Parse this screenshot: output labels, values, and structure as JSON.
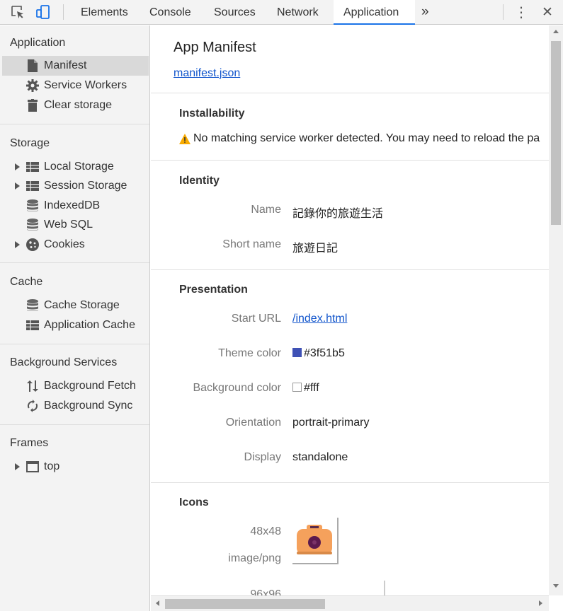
{
  "toolbar": {
    "tabs": [
      "Elements",
      "Console",
      "Sources",
      "Network",
      "Application"
    ],
    "active_tab": "Application",
    "more_glyph": "»",
    "menu_glyph": "⋮",
    "close_glyph": "✕"
  },
  "sidebar": {
    "application": {
      "heading": "Application",
      "items": [
        {
          "label": "Manifest",
          "icon": "document-icon"
        },
        {
          "label": "Service Workers",
          "icon": "gear-icon"
        },
        {
          "label": "Clear storage",
          "icon": "trash-icon"
        }
      ]
    },
    "storage": {
      "heading": "Storage",
      "items": [
        {
          "label": "Local Storage",
          "icon": "grid-icon"
        },
        {
          "label": "Session Storage",
          "icon": "grid-icon"
        },
        {
          "label": "IndexedDB",
          "icon": "database-icon"
        },
        {
          "label": "Web SQL",
          "icon": "database-icon"
        },
        {
          "label": "Cookies",
          "icon": "cookie-icon"
        }
      ]
    },
    "cache": {
      "heading": "Cache",
      "items": [
        {
          "label": "Cache Storage",
          "icon": "database-icon"
        },
        {
          "label": "Application Cache",
          "icon": "grid-icon"
        }
      ]
    },
    "background": {
      "heading": "Background Services",
      "items": [
        {
          "label": "Background Fetch",
          "icon": "arrows-updown-icon"
        },
        {
          "label": "Background Sync",
          "icon": "sync-icon"
        }
      ]
    },
    "frames": {
      "heading": "Frames",
      "items": [
        {
          "label": "top",
          "icon": "frame-icon"
        }
      ]
    }
  },
  "main": {
    "title": "App Manifest",
    "manifest_link": "manifest.json",
    "installability": {
      "title": "Installability",
      "warning": "No matching service worker detected. You may need to reload the pa"
    },
    "identity": {
      "title": "Identity",
      "rows": [
        {
          "label": "Name",
          "value": "記錄你的旅遊生活"
        },
        {
          "label": "Short name",
          "value": "旅遊日記"
        }
      ]
    },
    "presentation": {
      "title": "Presentation",
      "start_url_label": "Start URL",
      "start_url": "/index.html",
      "theme_color_label": "Theme color",
      "theme_color": "#3f51b5",
      "background_color_label": "Background color",
      "background_color": "#fff",
      "orientation_label": "Orientation",
      "orientation": "portrait-primary",
      "display_label": "Display",
      "display": "standalone"
    },
    "icons": {
      "title": "Icons",
      "items": [
        {
          "size": "48x48",
          "type": "image/png",
          "icon": "camera-icon"
        },
        {
          "size": "96x96"
        }
      ]
    }
  },
  "colors": {
    "accent": "#1a73e8",
    "link": "#1155cc",
    "warning": "#f9ab00",
    "camera_body": "#f5a15c"
  }
}
